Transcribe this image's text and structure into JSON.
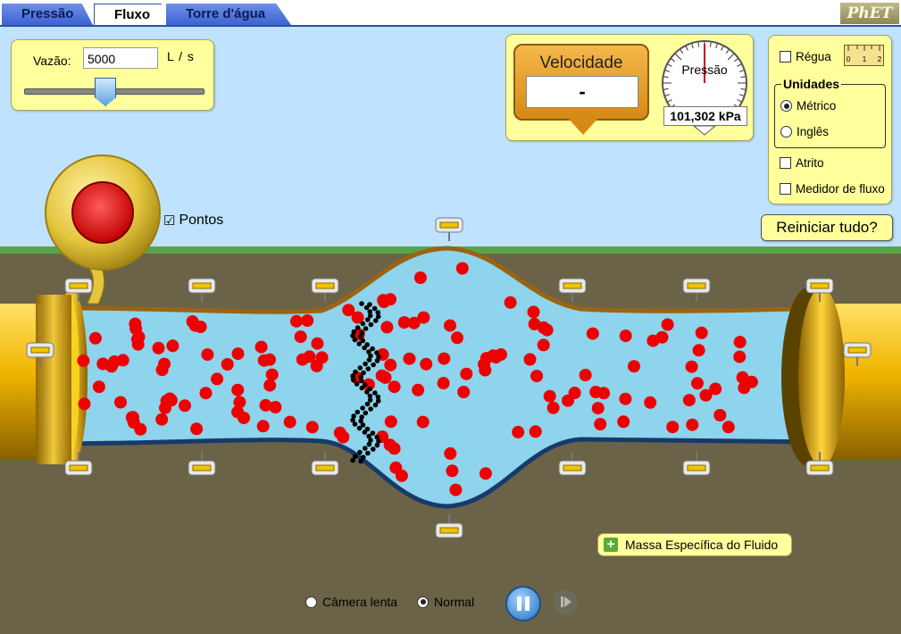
{
  "tabs": [
    {
      "label": "Pressão",
      "active": false
    },
    {
      "label": "Fluxo",
      "active": true
    },
    {
      "label": "Torre d'água",
      "active": false
    }
  ],
  "logo": "PhET",
  "flow": {
    "label": "Vazão:",
    "value": "5000",
    "unit": "L / s",
    "slider_fraction": 0.45
  },
  "velocity": {
    "title": "Velocidade",
    "value": "-"
  },
  "pressure_gauge": {
    "title": "Pressão",
    "reading": "101,302 kPa"
  },
  "options": {
    "ruler": {
      "label": "Régua",
      "checked": false
    },
    "ruler_ticks": [
      "0",
      "1",
      "2"
    ],
    "units_title": "Unidades",
    "units": [
      {
        "label": "Métrico",
        "selected": true
      },
      {
        "label": "Inglês",
        "selected": false
      }
    ],
    "friction": {
      "label": "Atrito",
      "checked": false
    },
    "flux_meter": {
      "label": "Medidor de fluxo",
      "checked": false
    }
  },
  "reset_label": "Reiniciar tudo?",
  "dots": {
    "label": "Pontos",
    "checked": true
  },
  "density": {
    "label": "Massa Específica do Fluido"
  },
  "playback": {
    "slow_label": "Câmera lenta",
    "normal_label": "Normal",
    "mode": "normal"
  },
  "colors": {
    "sky": "#bfe3ff",
    "grass": "#58a548",
    "ground": "#6b6347",
    "water": "#8dd4ec",
    "pipe_gold": "#f0b400",
    "pipe_top": "#9a6412",
    "pipe_bottom": "#173a6b",
    "particle": "#ee0000",
    "panel": "#ffff9c",
    "tab_blue": "#4a6fd9"
  }
}
